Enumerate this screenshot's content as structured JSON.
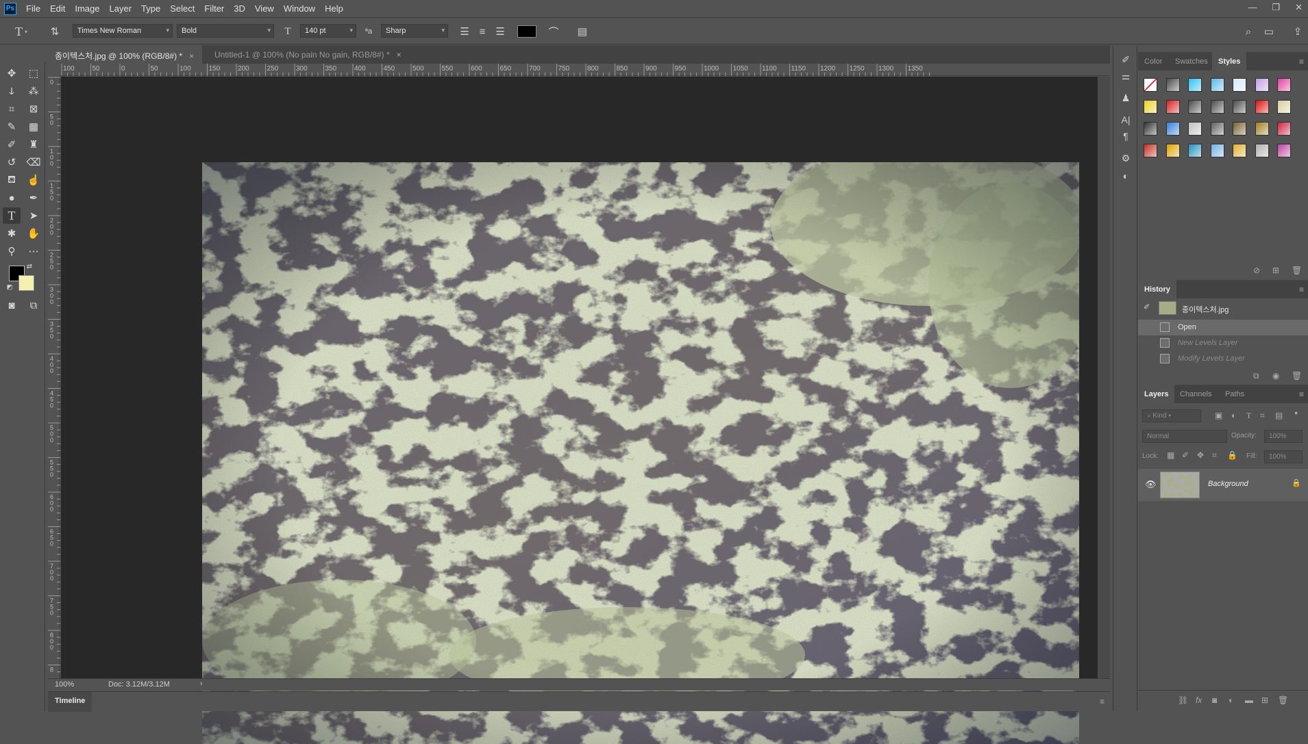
{
  "app": {
    "logo": "Ps"
  },
  "menu": [
    "File",
    "Edit",
    "Image",
    "Layer",
    "Type",
    "Select",
    "Filter",
    "3D",
    "View",
    "Window",
    "Help"
  ],
  "window_controls": [
    "—",
    "❐",
    "✕"
  ],
  "options_bar": {
    "font_family": "Times New Roman",
    "font_style": "Bold",
    "font_size": "140 pt",
    "antialias_label": "ªa",
    "antialias": "Sharp",
    "text_color": "#000000"
  },
  "tabs": [
    {
      "label": "종이텍스처.jpg @ 100% (RGB/8#) *",
      "close": "×",
      "active": true
    },
    {
      "label": "Untitled-1 @ 100% (No pain No gain, RGB/8#) *",
      "close": "×",
      "active": false
    }
  ],
  "ruler_h_labels": [
    "100",
    "50",
    "0",
    "50",
    "100",
    "150",
    "200",
    "250",
    "300",
    "350",
    "400",
    "450",
    "500",
    "550",
    "600",
    "650",
    "700",
    "750",
    "800",
    "850",
    "900",
    "950",
    "1000",
    "1050",
    "1100",
    "1150",
    "1200",
    "1250",
    "1300",
    "1350"
  ],
  "ruler_v_labels": [
    "0",
    "5 0",
    "1 0 0",
    "1 5 0",
    "2 0 0",
    "2 5 0",
    "3 0 0",
    "3 5 0",
    "4 0 0",
    "4 5 0",
    "5 0 0",
    "5 5 0",
    "6 0 0",
    "6 5 0",
    "7 0 0",
    "7 5 0",
    "8 0 0",
    "8"
  ],
  "status": {
    "zoom": "100%",
    "doc": "Doc: 3.12M/3.12M",
    "arrow": "›"
  },
  "timeline": {
    "label": "Timeline"
  },
  "tool_colors": {
    "foreground": "#000000",
    "background": "#f4f0b0"
  },
  "styles_panel": {
    "tabs": [
      "Color",
      "Swatches",
      "Styles"
    ],
    "active_tab": "Styles",
    "swatches": [
      "#ffffff",
      "#4a4a4a",
      "#2ec0f0",
      "#5fb8e8",
      "#d8e8f8",
      "#c0a0e0",
      "#e040a0",
      "#e8d020",
      "#d82020",
      "#4a4a4a",
      "#4a4a4a",
      "#4a4a4a",
      "#e01010",
      "#d8d0a0",
      "#303030",
      "#3080d8",
      "#c0c0c0",
      "#606060",
      "#7a6030",
      "#a08020",
      "#d02040",
      "#c03020",
      "#e0a000",
      "#2090c0",
      "#70b0e0",
      "#e0b030",
      "#b0b0b0",
      "#c040a0"
    ]
  },
  "history_panel": {
    "tab": "History",
    "snapshot": "종이텍스처.jpg",
    "items": [
      {
        "label": "Open",
        "selected": true,
        "dim": false
      },
      {
        "label": "New Levels Layer",
        "selected": false,
        "dim": true
      },
      {
        "label": "Modify Levels Layer",
        "selected": false,
        "dim": true
      }
    ]
  },
  "layers_panel": {
    "tabs": [
      "Layers",
      "Channels",
      "Paths"
    ],
    "active_tab": "Layers",
    "kind": "Kind",
    "blend_mode": "Normal",
    "opacity_label": "Opacity:",
    "opacity": "100%",
    "lock_label": "Lock:",
    "fill_label": "Fill:",
    "fill": "100%",
    "layers": [
      {
        "name": "Background",
        "visible": true,
        "locked": true
      }
    ]
  }
}
